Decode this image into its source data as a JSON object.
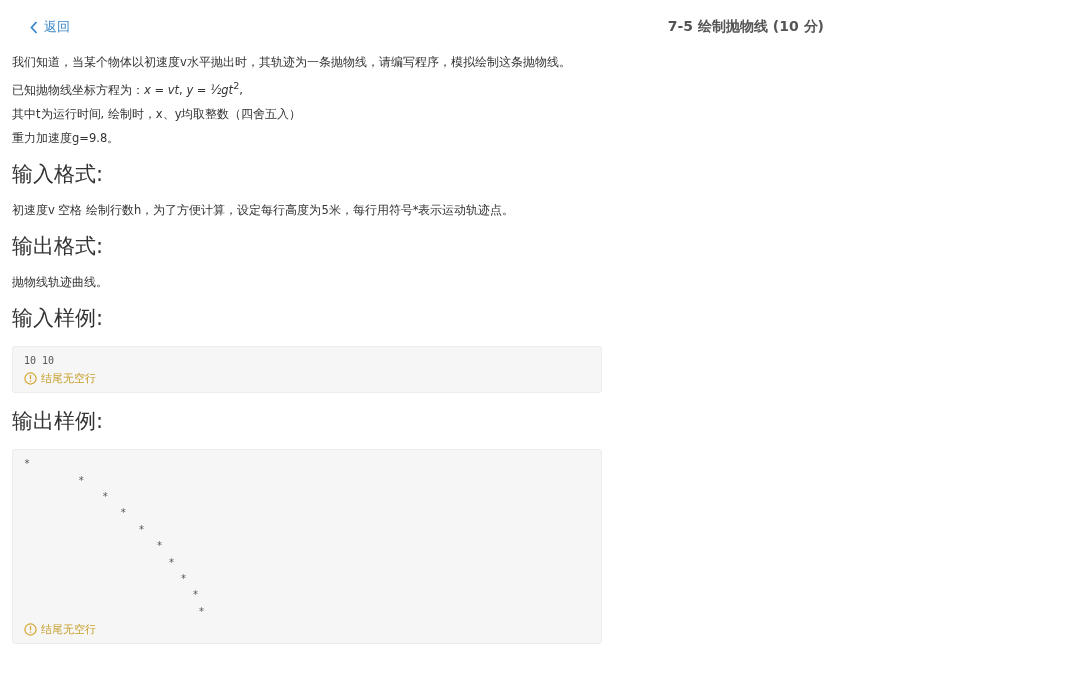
{
  "header": {
    "back": "返回",
    "title": "7-5 绘制抛物线 (10 分)"
  },
  "description": [
    "我们知道，当某个物体以初速度v水平抛出时，其轨迹为一条抛物线，请编写程序，模拟绘制这条抛物线。",
    "已知抛物线坐标方程为：*x* = *vt*, *y* = *½gt*$^{2}$,",
    "其中t为运行时间, 绘制时，x、y均取整数（四舍五入）",
    "重力加速度g=9.8。"
  ],
  "sections": [
    {
      "heading": "输入格式:",
      "kind": "text",
      "text": "初速度v 空格 绘制行数h，为了方便计算，设定每行高度为5米，每行用符号*表示运动轨迹点。"
    },
    {
      "heading": "输出格式:",
      "kind": "text",
      "text": "抛物线轨迹曲线。"
    },
    {
      "heading": "输入样例:",
      "kind": "code",
      "lines": [
        "10 10"
      ],
      "note": "结尾无空行"
    },
    {
      "heading": "输出样例:",
      "kind": "code",
      "lines": [
        "*",
        "         *",
        "             *",
        "                *",
        "                   *",
        "                      *",
        "                        *",
        "                          *",
        "                            *",
        "                             *"
      ],
      "note": "结尾无空行"
    }
  ]
}
